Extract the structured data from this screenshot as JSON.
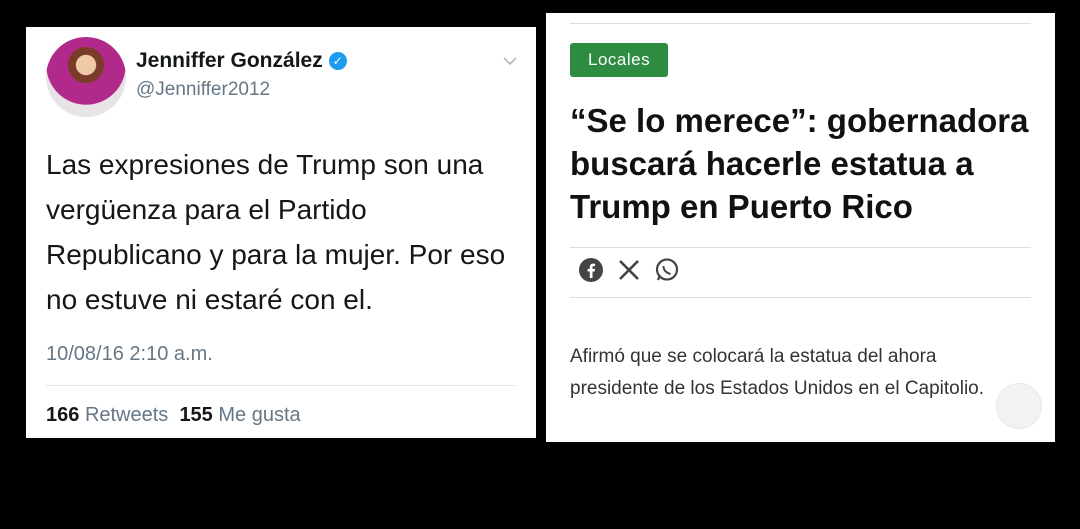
{
  "tweet": {
    "author_name": "Jenniffer González",
    "handle": "@Jenniffer2012",
    "text": "Las expresiones de Trump son una vergüenza para el Partido Republicano y para la mujer. Por eso no estuve ni estaré con el.",
    "timestamp": "10/08/16 2:10 a.m.",
    "retweets_count": "166",
    "retweets_label": "Retweets",
    "likes_count": "155",
    "likes_label": "Me gusta",
    "verified_color": "#1d9bf0"
  },
  "article": {
    "category": "Locales",
    "category_color": "#2e8b42",
    "headline": "“Se lo merece”: gobernadora buscará hacerle estatua a Trump en Puerto Rico",
    "share_icons": [
      "facebook-icon",
      "x-icon",
      "whatsapp-icon"
    ],
    "summary": "Afirmó que se colocará la estatua del ahora presidente de los Estados Unidos en el Capitolio."
  }
}
